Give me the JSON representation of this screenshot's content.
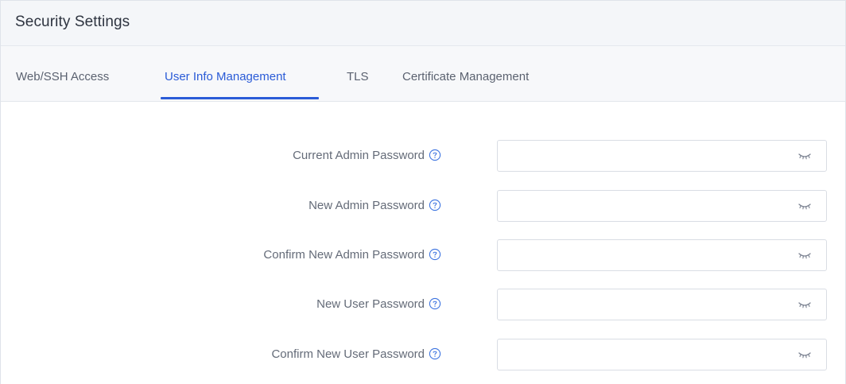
{
  "page": {
    "title": "Security Settings"
  },
  "tabs": [
    {
      "label": "Web/SSH Access",
      "active": false
    },
    {
      "label": "User Info Management",
      "active": true
    },
    {
      "label": "TLS",
      "active": false
    },
    {
      "label": "Certificate Management",
      "active": false
    }
  ],
  "form": {
    "fields": [
      {
        "label": "Current Admin Password",
        "value": "",
        "placeholder": "",
        "icon": "help-icon",
        "toggle_icon": "eye-closed-icon"
      },
      {
        "label": "New Admin Password",
        "value": "",
        "placeholder": "",
        "icon": "help-icon",
        "toggle_icon": "eye-closed-icon"
      },
      {
        "label": "Confirm New Admin Password",
        "value": "",
        "placeholder": "",
        "icon": "help-icon",
        "toggle_icon": "eye-closed-icon"
      },
      {
        "label": "New User Password",
        "value": "",
        "placeholder": "",
        "icon": "help-icon",
        "toggle_icon": "eye-closed-icon"
      },
      {
        "label": "Confirm New User Password",
        "value": "",
        "placeholder": "",
        "icon": "help-icon",
        "toggle_icon": "eye-closed-icon"
      }
    ]
  },
  "colors": {
    "accent": "#2a5bd7",
    "help_icon": "#3d74e0",
    "label_text": "#646b78",
    "title_bar_bg": "#f4f6f9"
  }
}
